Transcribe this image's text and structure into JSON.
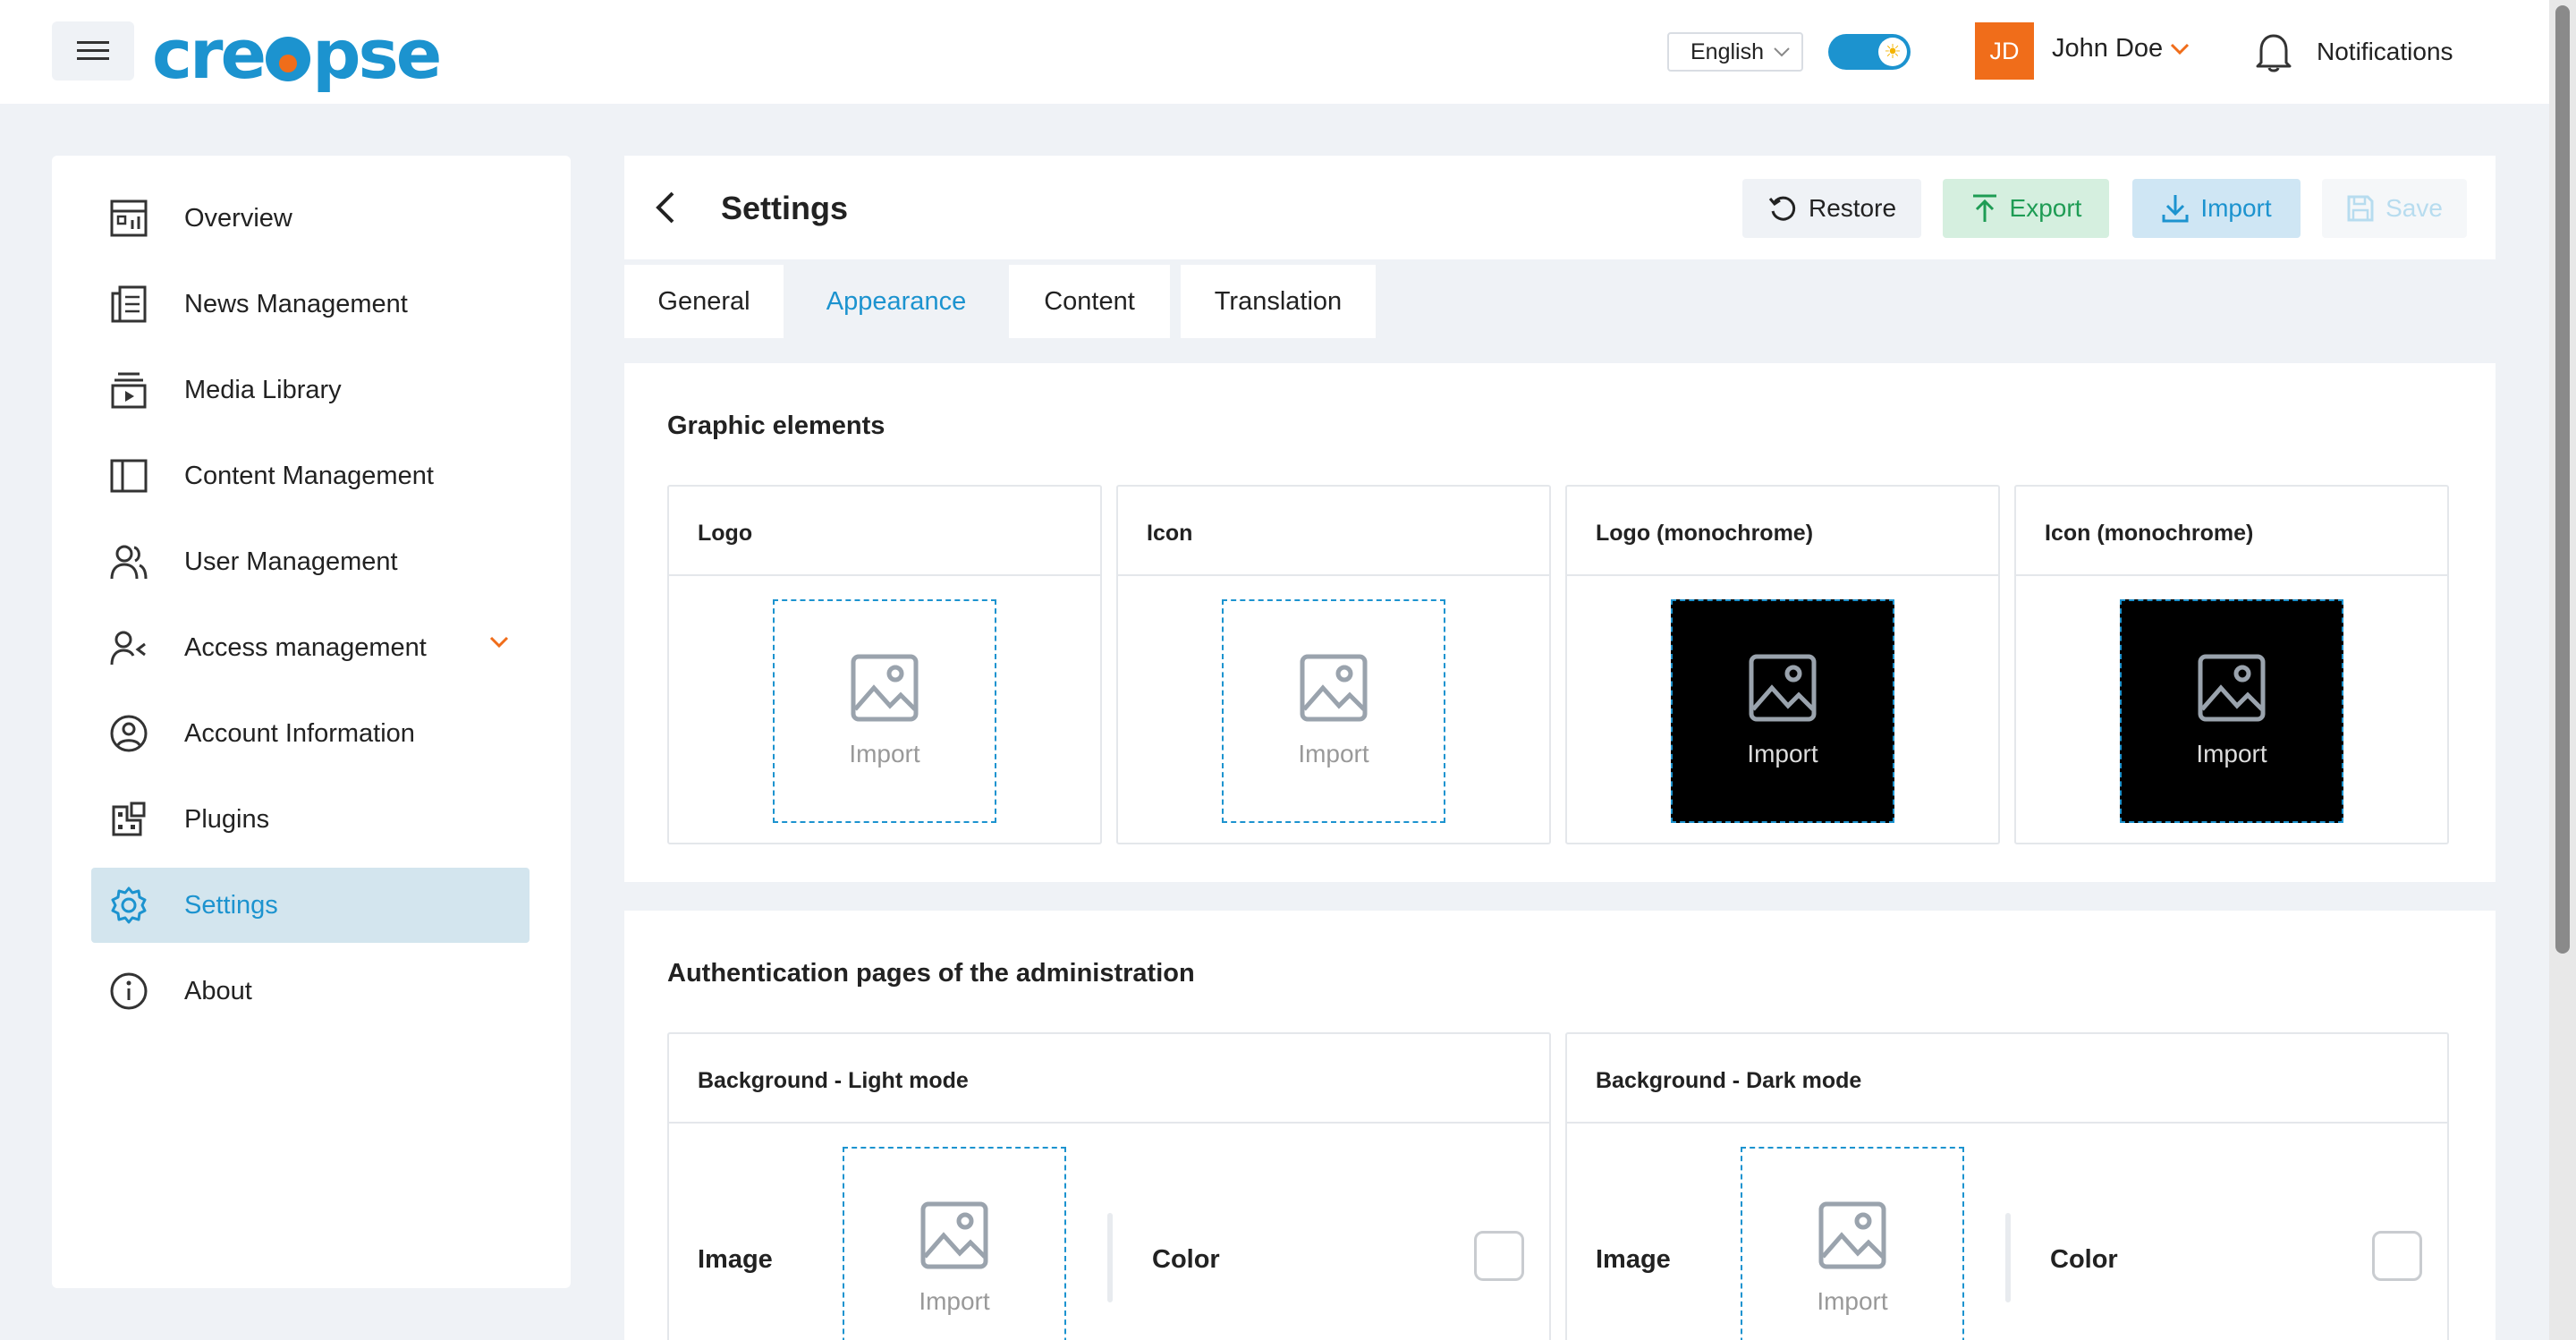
{
  "header": {
    "brand": "creopse",
    "language": "English",
    "user_initials": "JD",
    "user_name": "John Doe",
    "notifications_label": "Notifications"
  },
  "sidebar": {
    "items": [
      {
        "label": "Overview",
        "icon": "overview-icon"
      },
      {
        "label": "News Management",
        "icon": "news-icon"
      },
      {
        "label": "Media Library",
        "icon": "media-icon"
      },
      {
        "label": "Content Management",
        "icon": "content-icon"
      },
      {
        "label": "User Management",
        "icon": "users-icon"
      },
      {
        "label": "Access management",
        "icon": "access-icon"
      },
      {
        "label": "Account Information",
        "icon": "account-icon"
      },
      {
        "label": "Plugins",
        "icon": "plugins-icon"
      },
      {
        "label": "Settings",
        "icon": "gear-icon"
      },
      {
        "label": "About",
        "icon": "info-icon"
      }
    ]
  },
  "page": {
    "title": "Settings",
    "actions": {
      "restore": "Restore",
      "export": "Export",
      "import": "Import",
      "save": "Save"
    },
    "tabs": [
      "General",
      "Appearance",
      "Content",
      "Translation"
    ],
    "selected_tab": "Appearance"
  },
  "graphic_elements": {
    "title": "Graphic elements",
    "tiles": [
      {
        "label": "Logo",
        "action": "Import"
      },
      {
        "label": "Icon",
        "action": "Import"
      },
      {
        "label": "Logo (monochrome)",
        "action": "Import"
      },
      {
        "label": "Icon (monochrome)",
        "action": "Import"
      }
    ]
  },
  "auth_pages": {
    "title": "Authentication pages of the administration",
    "tiles": [
      {
        "label": "Background - Light mode",
        "image_label": "Image",
        "import_label": "Import",
        "color_label": "Color"
      },
      {
        "label": "Background - Dark mode",
        "image_label": "Image",
        "import_label": "Import",
        "color_label": "Color"
      }
    ]
  },
  "colors": {
    "brand": "#1c93cf",
    "accent": "#f06d1a",
    "export_green": "#1e9c54"
  }
}
